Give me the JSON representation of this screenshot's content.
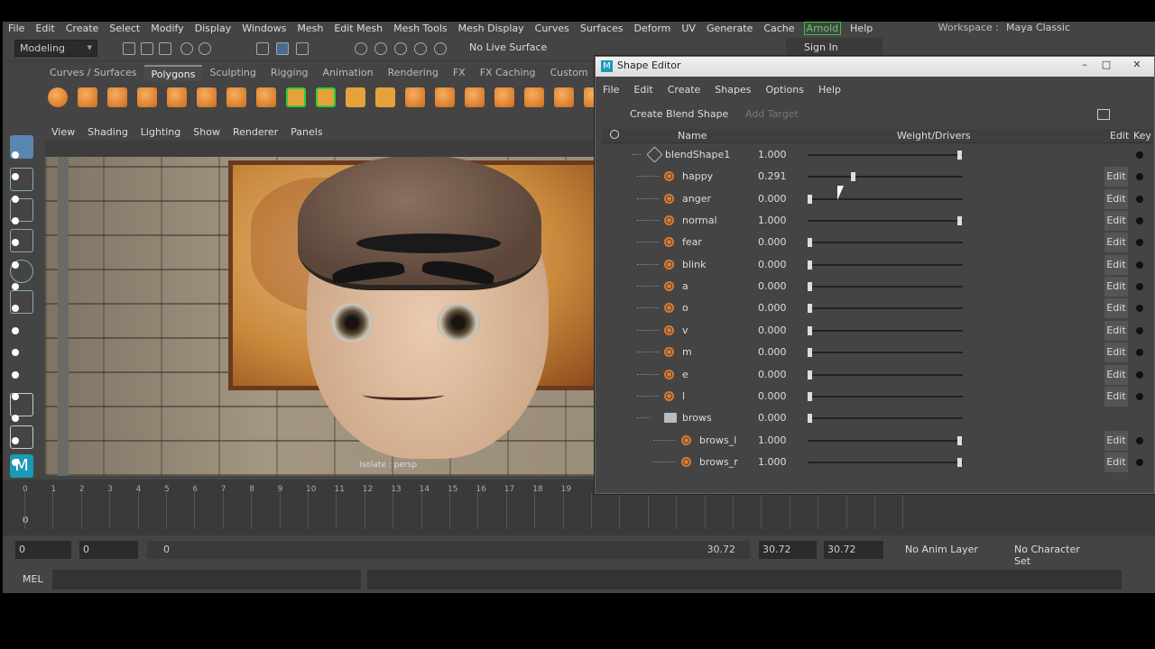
{
  "menubar": [
    "File",
    "Edit",
    "Create",
    "Select",
    "Modify",
    "Display",
    "Windows",
    "Mesh",
    "Edit Mesh",
    "Mesh Tools",
    "Mesh Display",
    "Curves",
    "Surfaces",
    "Deform",
    "UV",
    "Generate",
    "Cache",
    "Arnold",
    "Help"
  ],
  "workspace": {
    "label": "Workspace :",
    "value": "Maya Classic"
  },
  "status": {
    "mode": "Modeling",
    "live_surface": "No Live Surface",
    "sign_in": "Sign In"
  },
  "shelf_tabs": [
    "Curves / Surfaces",
    "Polygons",
    "Sculpting",
    "Rigging",
    "Animation",
    "Rendering",
    "FX",
    "FX Caching",
    "Custom"
  ],
  "panel_menu": [
    "View",
    "Shading",
    "Lighting",
    "Show",
    "Renderer",
    "Panels"
  ],
  "viewport": {
    "label": "Isolate : persp"
  },
  "timeline": {
    "ticks": [
      "0",
      "1",
      "2",
      "3",
      "4",
      "5",
      "6",
      "7",
      "8",
      "9",
      "10",
      "11",
      "12",
      "13",
      "14",
      "15",
      "16",
      "17",
      "18",
      "19"
    ],
    "current": "0"
  },
  "range": {
    "start": "0",
    "inner_start": "0",
    "slider_start": "0",
    "slider_end": "30.72",
    "end1": "30.72",
    "end2": "30.72",
    "anim_layer": "No Anim Layer",
    "char_set": "No Character Set"
  },
  "cmd": {
    "label": "MEL"
  },
  "shape_editor": {
    "title": "Shape Editor",
    "menu": [
      "File",
      "Edit",
      "Create",
      "Shapes",
      "Options",
      "Help"
    ],
    "create_blend": "Create Blend Shape",
    "add_target": "Add Target",
    "headers": {
      "name": "Name",
      "weight": "Weight/Drivers",
      "edit": "Edit",
      "key": "Key"
    },
    "rows": [
      {
        "name": "blendShape1",
        "value": "1.000",
        "frac": 1.0,
        "type": "blend",
        "edit": false
      },
      {
        "name": "happy",
        "value": "0.291",
        "frac": 0.291,
        "type": "target",
        "edit": true
      },
      {
        "name": "anger",
        "value": "0.000",
        "frac": 0,
        "type": "target",
        "edit": true
      },
      {
        "name": "normal",
        "value": "1.000",
        "frac": 1.0,
        "type": "target",
        "edit": true
      },
      {
        "name": "fear",
        "value": "0.000",
        "frac": 0,
        "type": "target",
        "edit": true
      },
      {
        "name": "blink",
        "value": "0.000",
        "frac": 0,
        "type": "target",
        "edit": true
      },
      {
        "name": "a",
        "value": "0.000",
        "frac": 0,
        "type": "target",
        "edit": true
      },
      {
        "name": "o",
        "value": "0.000",
        "frac": 0,
        "type": "target",
        "edit": true
      },
      {
        "name": "v",
        "value": "0.000",
        "frac": 0,
        "type": "target",
        "edit": true
      },
      {
        "name": "m",
        "value": "0.000",
        "frac": 0,
        "type": "target",
        "edit": true
      },
      {
        "name": "e",
        "value": "0.000",
        "frac": 0,
        "type": "target",
        "edit": true
      },
      {
        "name": "l",
        "value": "0.000",
        "frac": 0,
        "type": "target",
        "edit": true
      },
      {
        "name": "brows",
        "value": "0.000",
        "frac": 0,
        "type": "group",
        "edit": false
      },
      {
        "name": "brows_l",
        "value": "1.000",
        "frac": 1.0,
        "type": "subtarget",
        "edit": true
      },
      {
        "name": "brows_r",
        "value": "1.000",
        "frac": 1.0,
        "type": "subtarget",
        "edit": true
      }
    ],
    "edit_label": "Edit"
  },
  "colors": {
    "panel": "#444444",
    "accent_orange": "#e07a2c",
    "arnold": "#33cc33",
    "title_bar": "#e6e6e6"
  }
}
